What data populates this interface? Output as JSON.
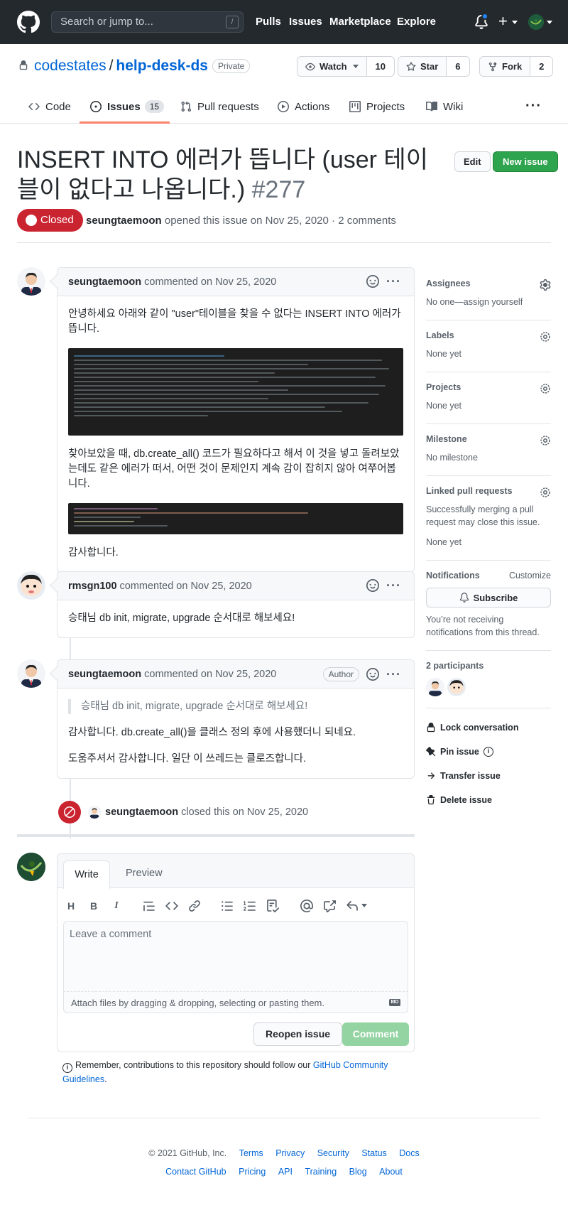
{
  "header": {
    "search_placeholder": "Search or jump to...",
    "search_shortcut": "/",
    "nav": [
      "Pulls",
      "Issues",
      "Marketplace",
      "Explore"
    ],
    "plus": "+"
  },
  "repo": {
    "owner": "codestates",
    "separator": "/",
    "name": "help-desk-ds",
    "visibility": "Private",
    "watch_label": "Watch",
    "watch_count": "10",
    "star_label": "Star",
    "star_count": "6",
    "fork_label": "Fork",
    "fork_count": "2"
  },
  "repo_nav": {
    "code": "Code",
    "issues": "Issues",
    "issues_count": "15",
    "pull_requests": "Pull requests",
    "actions": "Actions",
    "projects": "Projects",
    "wiki": "Wiki",
    "more": "···"
  },
  "issue": {
    "title": "INSERT INTO 에러가 뜹니다 (user 테이블이 없다고 나옵니다.)",
    "number": "#277",
    "edit_label": "Edit",
    "new_issue_label": "New issue",
    "state": "Closed",
    "author": "seungtaemoon",
    "meta": "opened this issue on Nov 25, 2020 · 2 comments"
  },
  "comments": [
    {
      "author": "seungtaemoon",
      "action": "commented on Nov 25, 2020",
      "p1": "안녕하세요 아래와 같이 \"user\"테이블을 찾을 수 없다는 INSERT INTO 에러가 뜹니다.",
      "p2": "찾아보았을 때, db.create_all() 코드가 필요하다고 해서 이 것을 넣고 돌려보았는데도 같은 에러가 떠서, 어떤 것이 문제인지 계속 감이 잡히지 않아 여쭈어봅니다.",
      "p3": "감사합니다."
    },
    {
      "author": "rmsgn100",
      "action": "commented on Nov 25, 2020",
      "p1": "승태님 db init, migrate, upgrade 순서대로 해보세요!"
    },
    {
      "author": "seungtaemoon",
      "action": "commented on Nov 25, 2020",
      "badge": "Author",
      "quote": "승태님 db init, migrate, upgrade 순서대로 해보세요!",
      "p1": "감사합니다. db.create_all()을 클래스 정의 후에 사용했더니 되네요.",
      "p2": "도움주셔서 감사합니다. 일단 이 쓰레드는 클로즈합니다."
    }
  ],
  "closed_event": {
    "actor": "seungtaemoon",
    "text": "closed this on Nov 25, 2020"
  },
  "form": {
    "tab_write": "Write",
    "tab_preview": "Preview",
    "placeholder": "Leave a comment",
    "attach_hint": "Attach files by dragging & dropping, selecting or pasting them.",
    "md_badge": "MD",
    "reopen_label": "Reopen issue",
    "comment_label": "Comment",
    "guidelines_prefix": "Remember, contributions to this repository should follow our ",
    "guidelines_link": "GitHub Community Guidelines",
    "guidelines_suffix": "."
  },
  "sidebar": {
    "assignees_title": "Assignees",
    "assignees_value": "No one—assign yourself",
    "labels_title": "Labels",
    "labels_value": "None yet",
    "projects_title": "Projects",
    "projects_value": "None yet",
    "milestone_title": "Milestone",
    "milestone_value": "No milestone",
    "linked_title": "Linked pull requests",
    "linked_desc": "Successfully merging a pull request may close this issue.",
    "linked_value": "None yet",
    "notifications_title": "Notifications",
    "customize": "Customize",
    "subscribe": "Subscribe",
    "notifications_desc": "You’re not receiving notifications from this thread.",
    "participants_title": "2 participants",
    "lock": "Lock conversation",
    "pin": "Pin issue",
    "transfer": "Transfer issue",
    "delete": "Delete issue"
  },
  "footer": {
    "copyright": "© 2021 GitHub, Inc.",
    "row1": [
      "Terms",
      "Privacy",
      "Security",
      "Status",
      "Docs"
    ],
    "row2": [
      "Contact GitHub",
      "Pricing",
      "API",
      "Training",
      "Blog",
      "About"
    ]
  },
  "colors": {
    "header_bg": "#24292e",
    "closed_red": "#cb2431",
    "link_blue": "#0366d6",
    "green": "#2ea44f",
    "tab_underline": "#f9826c"
  }
}
